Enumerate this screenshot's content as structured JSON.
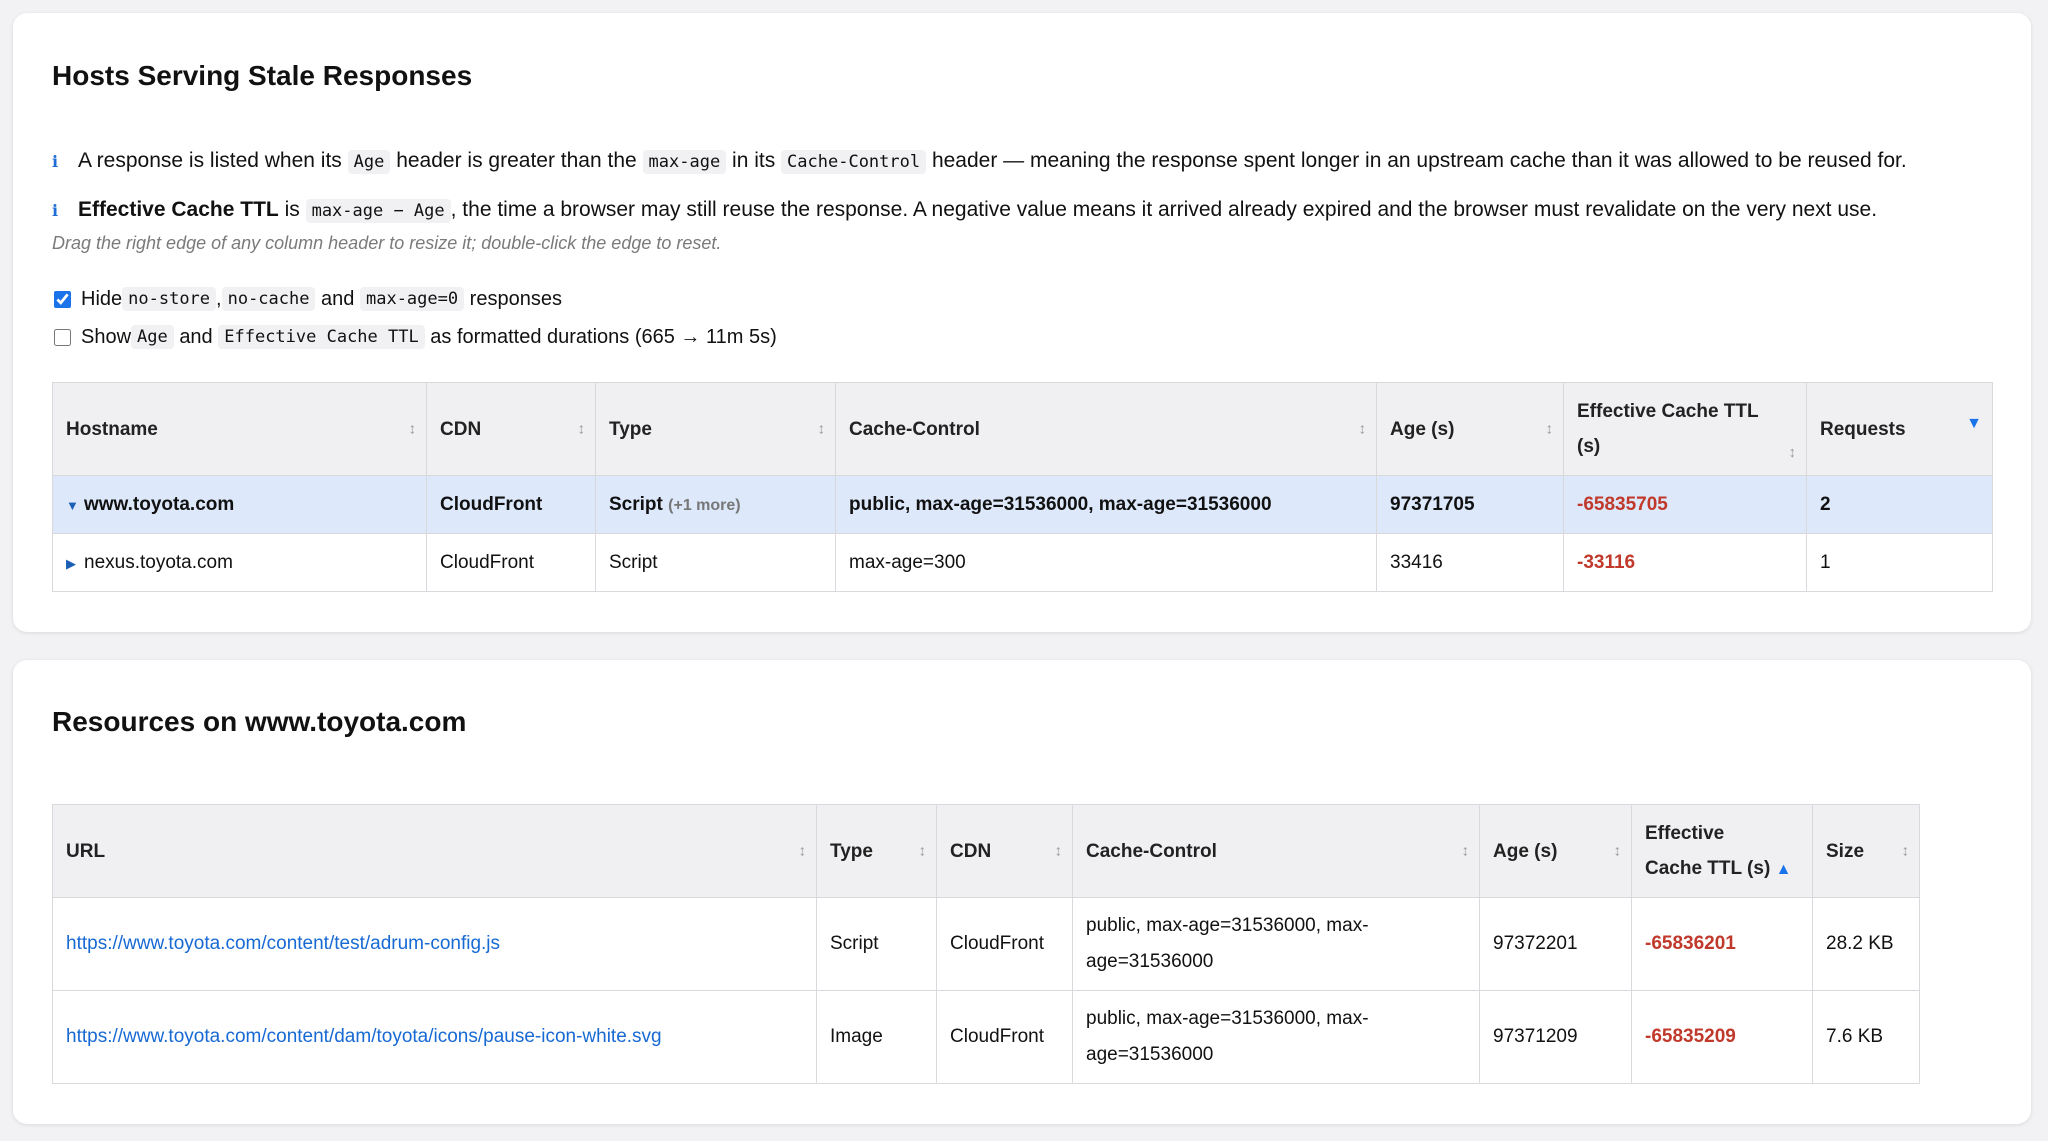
{
  "hosts": {
    "title": "Hosts Serving Stale Responses",
    "info1": {
      "t1": "A response is listed when its ",
      "c1": "Age",
      "t2": " header is greater than the ",
      "c2": "max-age",
      "t3": " in its ",
      "c3": "Cache-Control",
      "t4": " header — meaning the response spent longer in an upstream cache than it was allowed to be reused for."
    },
    "info2": {
      "bold": "Effective Cache TTL",
      "t1": " is ",
      "c1": "max-age − Age",
      "t2": ", the time a browser may still reuse the response. A negative value means it arrived already expired and the browser must revalidate on the very next use."
    },
    "hint": "Drag the right edge of any column header to resize it; double-click the edge to reset.",
    "opt1": {
      "t1": "Hide ",
      "c1": "no-store",
      "t2": ", ",
      "c2": "no-cache",
      "t3": " and ",
      "c3": "max-age=0",
      "t4": " responses",
      "checked": true
    },
    "opt2": {
      "t1": "Show ",
      "c1": "Age",
      "t2": " and ",
      "c2": "Effective Cache TTL",
      "t3": " as formatted durations (665 → 11m 5s)",
      "checked": false
    },
    "columns": [
      "Hostname",
      "CDN",
      "Type",
      "Cache-Control",
      "Age (s)",
      "Effective Cache TTL (s)",
      "Requests"
    ],
    "rows": [
      {
        "hostname": "www.toyota.com",
        "cdn": "CloudFront",
        "type": "Script",
        "type_more": "(+1 more)",
        "cache_control": "public, max-age=31536000, max-age=31536000",
        "age": "97371705",
        "ttl": "-65835705",
        "requests": "2",
        "expanded": true
      },
      {
        "hostname": "nexus.toyota.com",
        "cdn": "CloudFront",
        "type": "Script",
        "type_more": "",
        "cache_control": "max-age=300",
        "age": "33416",
        "ttl": "-33116",
        "requests": "1",
        "expanded": false
      }
    ]
  },
  "resources": {
    "title": "Resources on www.toyota.com",
    "columns": [
      "URL",
      "Type",
      "CDN",
      "Cache-Control",
      "Age (s)",
      "Effective Cache TTL (s)",
      "Size"
    ],
    "ttl_header": {
      "line1": "Effective",
      "line2": "Cache TTL (s)"
    },
    "rows": [
      {
        "url": "https://www.toyota.com/content/test/adrum-config.js",
        "type": "Script",
        "cdn": "CloudFront",
        "cc1": "public, max-age=31536000, max-",
        "cc2": "age=31536000",
        "age": "97372201",
        "ttl": "-65836201",
        "size": "28.2 KB"
      },
      {
        "url": "https://www.toyota.com/content/dam/toyota/icons/pause-icon-white.svg",
        "type": "Image",
        "cdn": "CloudFront",
        "cc1": "public, max-age=31536000, max-",
        "cc2": "age=31536000",
        "age": "97371209",
        "ttl": "-65835209",
        "size": "7.6 KB"
      }
    ]
  },
  "icons": {
    "info": "info-icon",
    "sort": "sort-icon",
    "expand": "caret-icon"
  }
}
